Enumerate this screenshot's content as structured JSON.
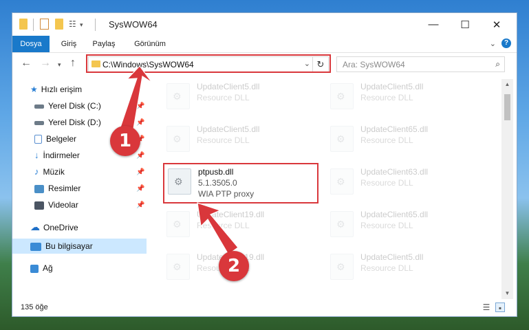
{
  "window": {
    "title": "SysWOW64",
    "controls": {
      "minimize": "—",
      "maximize": "☐",
      "close": "✕"
    }
  },
  "ribbon": {
    "tabs": [
      {
        "label": "Dosya",
        "active": true
      },
      {
        "label": "Giriş",
        "active": false
      },
      {
        "label": "Paylaş",
        "active": false
      },
      {
        "label": "Görünüm",
        "active": false
      }
    ],
    "help": "?"
  },
  "navbar": {
    "address": "C:\\Windows\\SysWOW64",
    "search_placeholder": "Ara: SysWOW64"
  },
  "sidebar": {
    "items": [
      {
        "label": "Hızlı erişim",
        "icon": "star-icon",
        "color": "#2a7fd4"
      },
      {
        "label": "Yerel Disk (C:)",
        "icon": "drive-icon",
        "color": "#6d7b88",
        "pinned": true
      },
      {
        "label": "Yerel Disk (D:)",
        "icon": "drive-icon",
        "color": "#6d7b88",
        "pinned": true
      },
      {
        "label": "Belgeler",
        "icon": "documents-icon",
        "color": "#5a8fd0",
        "pinned": true
      },
      {
        "label": "İndirmeler",
        "icon": "download-icon",
        "color": "#2a7fd4",
        "pinned": true
      },
      {
        "label": "Müzik",
        "icon": "music-icon",
        "color": "#2a7fd4",
        "pinned": true
      },
      {
        "label": "Resimler",
        "icon": "pictures-icon",
        "color": "#4a8fc7",
        "pinned": true
      },
      {
        "label": "Videolar",
        "icon": "video-icon",
        "color": "#4b5563",
        "pinned": true
      },
      {
        "label": "OneDrive",
        "icon": "cloud-icon",
        "color": "#1e6fc7"
      },
      {
        "label": "Bu bilgisayar",
        "icon": "computer-icon",
        "color": "#3a8bd6",
        "selected": true
      },
      {
        "label": "Ağ",
        "icon": "network-icon",
        "color": "#3a8bd6"
      }
    ]
  },
  "files": [
    {
      "name": "UpdateClient5.dll",
      "type": "Resource DLL",
      "faded": true
    },
    {
      "name": "UpdateClient5.dll",
      "type": "Resource DLL",
      "faded": true
    },
    {
      "name": "UpdateClient5.dll",
      "type": "Resource DLL",
      "faded": true
    },
    {
      "name": "UpdateClient65.dll",
      "type": "Resource DLL",
      "faded": true
    },
    {
      "name": "ptpusb.dll",
      "version": "5.1.3505.0",
      "type": "WIA PTP proxy",
      "faded": false,
      "highlighted": true
    },
    {
      "name": "UpdateClient63.dll",
      "type": "Resource DLL",
      "faded": true
    },
    {
      "name": "UpdateClient19.dll",
      "type": "Resource DLL",
      "faded": true
    },
    {
      "name": "UpdateClient65.dll",
      "type": "Resource DLL",
      "faded": true
    },
    {
      "name": "UpdateClient19.dll",
      "type": "Resource DLL",
      "faded": true
    },
    {
      "name": "UpdateClient5.dll",
      "type": "Resource DLL",
      "faded": true
    }
  ],
  "status": {
    "count": "135 öğe"
  },
  "annotations": {
    "marker1": "1",
    "marker2": "2",
    "color": "#d9373b"
  }
}
